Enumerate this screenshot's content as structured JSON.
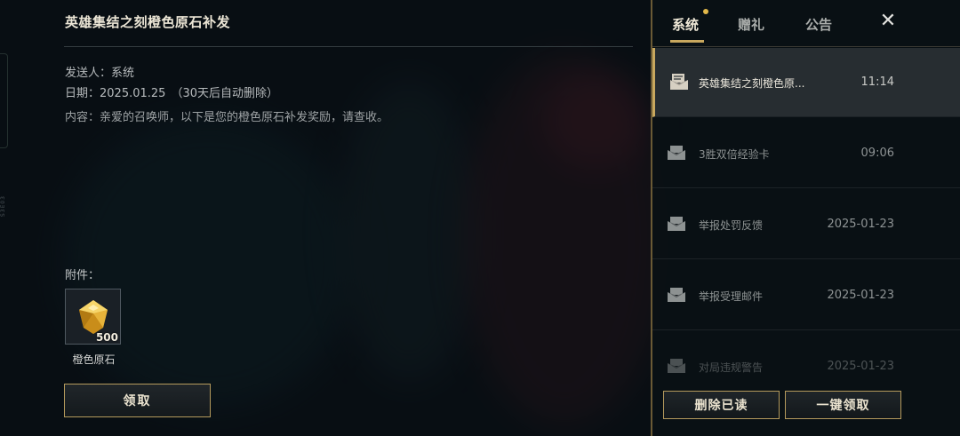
{
  "mail_detail": {
    "title": "英雄集结之刻橙色原石补发",
    "sender": "发送人：系统",
    "date": "日期：2025.01.25",
    "expiry": "（30天后自动删除）",
    "content": "内容：亲爱的召唤师，以下是您的橙色原石补发奖励，请查收。",
    "attachments_label": "附件：",
    "attachment": {
      "icon": "gem-icon",
      "quantity": "500",
      "name": "橙色原石"
    },
    "claim_label": "领取"
  },
  "side_label": "S3E03",
  "mailbox": {
    "tabs": [
      {
        "label": "系统",
        "active": true,
        "has_dot": true
      },
      {
        "label": "赠礼",
        "active": false
      },
      {
        "label": "公告",
        "active": false
      }
    ],
    "close_icon": "close-icon",
    "items": [
      {
        "subject": "英雄集结之刻橙色原...",
        "time": "11:14",
        "icon": "opened-mail-icon",
        "selected": true
      },
      {
        "subject": "3胜双倍经验卡",
        "time": "09:06",
        "icon": "mail-icon"
      },
      {
        "subject": "举报处罚反馈",
        "time": "2025-01-23",
        "icon": "mail-icon"
      },
      {
        "subject": "举报受理邮件",
        "time": "2025-01-23",
        "icon": "mail-icon"
      },
      {
        "subject": "对局违规警告",
        "time": "2025-01-23",
        "icon": "mail-icon"
      }
    ],
    "delete_read_label": "删除已读",
    "claim_all_label": "一键领取"
  },
  "colors": {
    "accent_gold": "#c9a85e",
    "button_border": "#b59a5c"
  }
}
